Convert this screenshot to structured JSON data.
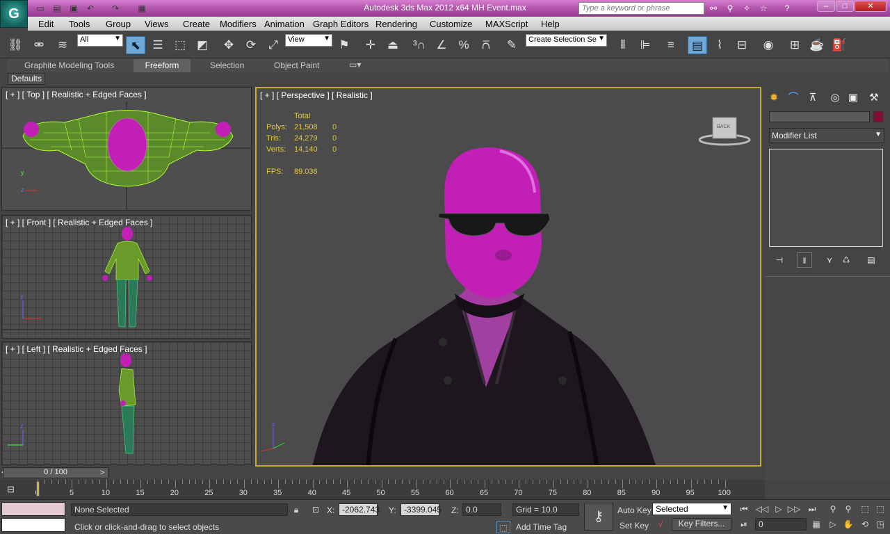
{
  "window": {
    "title": "Autodesk 3ds Max  2012 x64      MH Event.max",
    "search_placeholder": "Type a keyword or phrase",
    "minimize": "–",
    "maximize": "□",
    "close": "✕"
  },
  "app_button": "G",
  "menu": [
    "Edit",
    "Tools",
    "Group",
    "Views",
    "Create",
    "Modifiers",
    "Animation",
    "Graph Editors",
    "Rendering",
    "Customize",
    "MAXScript",
    "Help"
  ],
  "toolbar": {
    "selection_filter": "All",
    "ref_coord": "View",
    "named_selection": "Create Selection Se"
  },
  "ribbon": {
    "tabs": [
      "Graphite Modeling Tools",
      "Freeform",
      "Selection",
      "Object Paint"
    ],
    "active_tab": "Freeform",
    "panel": "Defaults"
  },
  "viewports": {
    "top": "[ + ] [ Top ] [ Realistic + Edged Faces ]",
    "front": "[ + ] [ Front ] [ Realistic + Edged Faces ]",
    "left": "[ + ] [ Left ] [ Realistic + Edged Faces ]",
    "perspective": "[ + ] [ Perspective ] [ Realistic ]"
  },
  "stats": {
    "header": "Total",
    "rows": [
      {
        "label": "Polys:",
        "total": "21,508",
        "selected": "0"
      },
      {
        "label": "Tris:",
        "total": "24,279",
        "selected": "0"
      },
      {
        "label": "Verts:",
        "total": "14,140",
        "selected": "0"
      }
    ],
    "fps_label": "FPS:",
    "fps": "89.036"
  },
  "viewcube_label": "BACK",
  "command_panel": {
    "modifier_list": "Modifier List",
    "accent_color": "#8a0a3a"
  },
  "timeline": {
    "frame": "0 / 100",
    "ticks": [
      "0",
      "5",
      "10",
      "15",
      "20",
      "25",
      "30",
      "35",
      "40",
      "45",
      "50",
      "55",
      "60",
      "65",
      "70",
      "75",
      "80",
      "85",
      "90",
      "95",
      "100"
    ]
  },
  "status": {
    "selection": "None Selected",
    "prompt": "Click or click-and-drag to select objects",
    "x_label": "X:",
    "x": "-2062.743",
    "y_label": "Y:",
    "y": "-3399.045",
    "z_label": "Z:",
    "z": "0.0",
    "grid": "Grid = 10.0",
    "add_time_tag": "Add Time Tag",
    "auto_key": "Auto Key",
    "set_key": "Set Key",
    "key_mode": "Selected",
    "key_filters": "Key Filters...",
    "current_frame": "0"
  },
  "colors": {
    "title_pink": "#b458ae",
    "stat_yellow": "#e8c83a",
    "active_border": "#c9a83e",
    "character_magenta": "#c21fb6"
  }
}
